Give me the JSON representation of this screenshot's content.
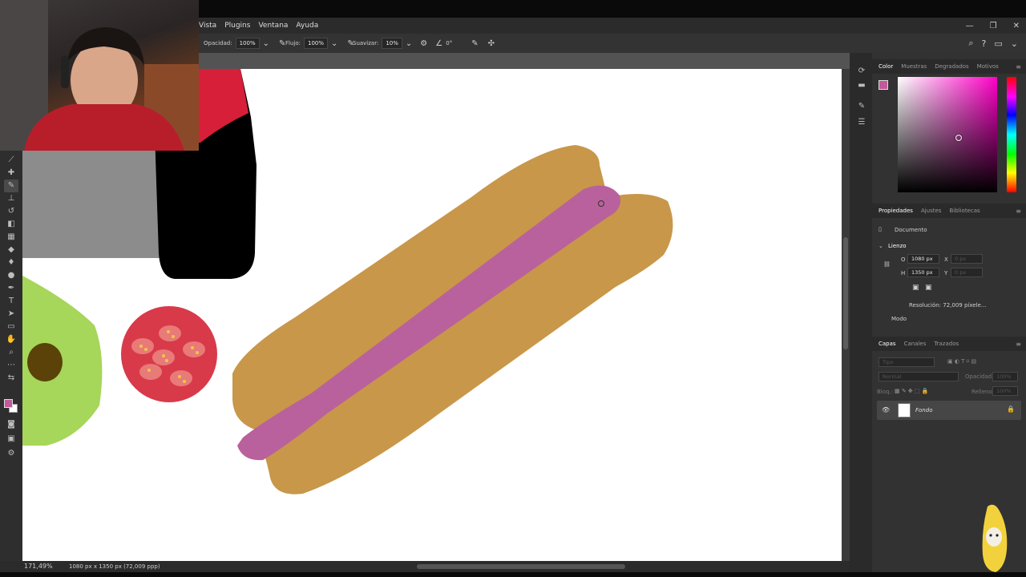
{
  "menu": {
    "items": [
      "Vista",
      "Plugins",
      "Ventana",
      "Ayuda"
    ]
  },
  "window_controls": {
    "minimize": "—",
    "maximize": "❐",
    "close": "✕"
  },
  "options_bar": {
    "opacity_label": "Opacidad:",
    "opacity_value": "100%",
    "flow_label": "Flujo:",
    "flow_value": "100%",
    "smoothing_label": "Suavizar:",
    "smoothing_value": "10%",
    "angle_value": "0°"
  },
  "panels": {
    "color_tabs": [
      "Color",
      "Muestras",
      "Degradados",
      "Motivos"
    ],
    "properties_tabs": [
      "Propiedades",
      "Ajustes",
      "Bibliotecas"
    ],
    "properties": {
      "document_label": "Documento",
      "canvas_section": "Lienzo",
      "width_label": "O",
      "width_value": "1080 px",
      "height_label": "H",
      "height_value": "1350 px",
      "x_label": "X",
      "y_label": "Y",
      "x_value": "0 px",
      "y_value": "0 px",
      "resolution": "Resolución: 72,009 píxele...",
      "mode_label": "Modo"
    },
    "layers_tabs": [
      "Capas",
      "Canales",
      "Trazados"
    ],
    "layers": {
      "filter_placeholder": "Tipo",
      "blend_mode": "Normal",
      "opacity_label": "Opacidad:",
      "opacity_value": "100%",
      "lock_label": "Bloq.:",
      "fill_label": "Relleno:",
      "fill_value": "100%",
      "layer_name": "Fondo"
    }
  },
  "status_bar": {
    "zoom": "171,49%",
    "doc_info": "1080 px x 1350 px (72,009 ppp)"
  },
  "colors": {
    "foreground": "#c05a9a",
    "bun": "#c8974a",
    "sausage": "#b9619c",
    "tomato": "#d83a4a",
    "avocado": "#a6d65a",
    "pit": "#5a4208"
  }
}
